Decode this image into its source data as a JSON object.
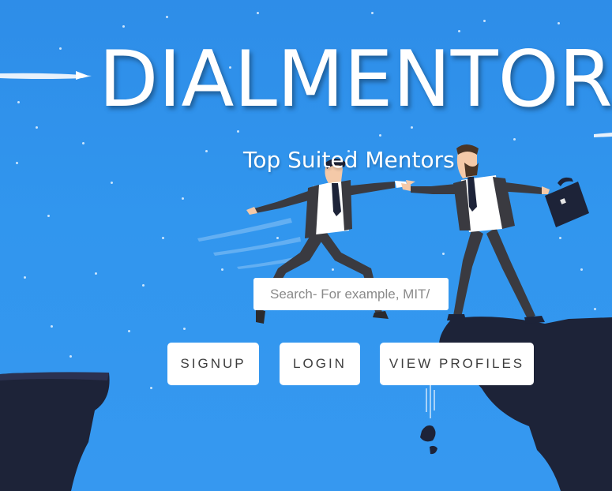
{
  "hero": {
    "title": "DIALMENTOR",
    "subtitle": "Top Suited Mentors"
  },
  "search": {
    "placeholder": "Search- For example, MIT/"
  },
  "buttons": {
    "signup": "SIGNUP",
    "login": "LOGIN",
    "view_profiles": "VIEW PROFILES"
  },
  "colors": {
    "sky": "#3196ee",
    "cliff": "#1d2338",
    "button_bg": "#ffffff",
    "button_text": "#3d3d3d"
  },
  "icons": {
    "briefcase": "briefcase-icon",
    "airplane_trail": "airplane-trail-icon"
  }
}
